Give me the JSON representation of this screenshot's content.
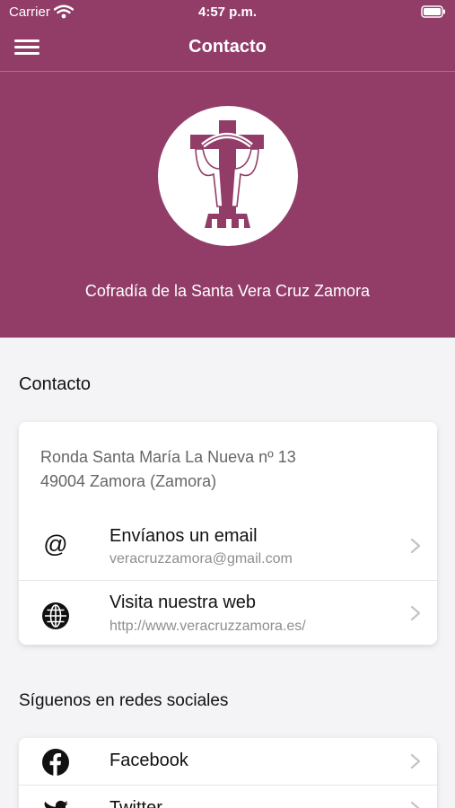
{
  "status_bar": {
    "carrier": "Carrier",
    "time": "4:57 p.m."
  },
  "nav": {
    "title": "Contacto"
  },
  "hero": {
    "name": "Cofradía de la Santa Vera Cruz Zamora"
  },
  "contact": {
    "section_title": "Contacto",
    "address_line1": "Ronda Santa María La Nueva nº 13",
    "address_line2": "49004 Zamora (Zamora)",
    "email": {
      "icon": "@",
      "title": "Envíanos un email",
      "value": "veracruzzamora@gmail.com"
    },
    "web": {
      "title": "Visita nuestra web",
      "value": "http://www.veracruzzamora.es/"
    }
  },
  "social": {
    "section_title": "Síguenos en redes sociales",
    "items": [
      {
        "label": "Facebook",
        "icon": "facebook-icon"
      },
      {
        "label": "Twitter",
        "icon": "twitter-icon"
      }
    ]
  },
  "colors": {
    "brand": "#913d68",
    "background": "#f4f4f6",
    "card": "#ffffff"
  }
}
